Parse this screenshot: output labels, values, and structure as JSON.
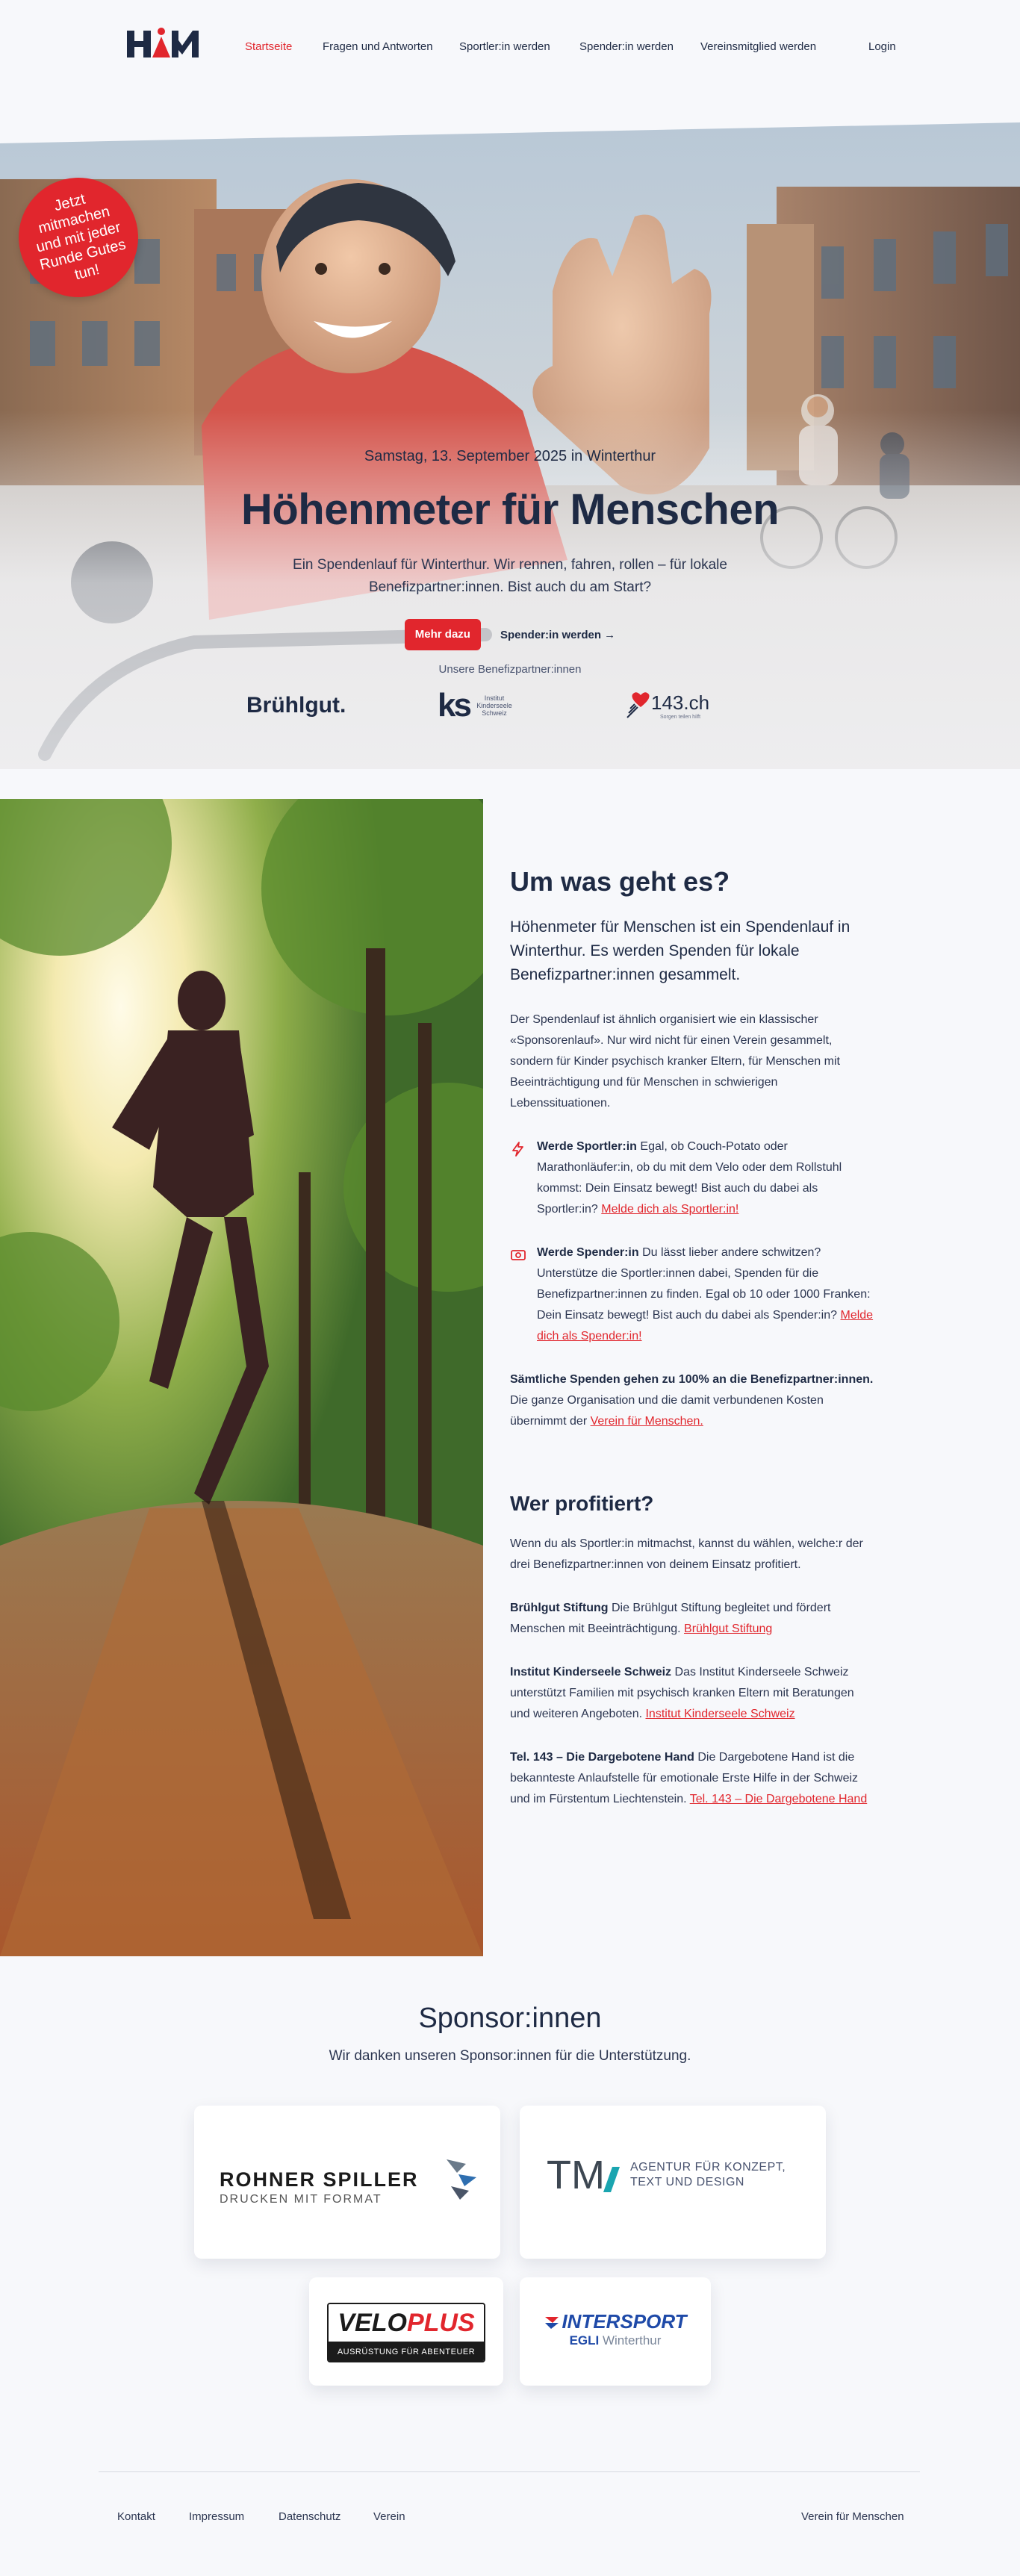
{
  "nav": {
    "items": [
      {
        "label": "Startseite",
        "active": true
      },
      {
        "label": "Fragen und Antworten",
        "active": false
      },
      {
        "label": "Sportler:in werden",
        "active": false
      },
      {
        "label": "Spender:in werden",
        "active": false
      },
      {
        "label": "Vereinsmitglied werden",
        "active": false
      }
    ],
    "login": "Login"
  },
  "hero": {
    "badge": "Jetzt mitmachen und mit jeder Runde Gutes tun!",
    "date": "Samstag, 13. September 2025 in Winterthur",
    "title": "Höhenmeter für Menschen",
    "lead": "Ein Spendenlauf für Winterthur. Wir rennen, fahren, rollen – für lokale Benefizpartner:innen. Bist auch du am Start?",
    "primary_button": "Mehr dazu",
    "secondary_button": "Spender:in werden →",
    "partners_label": "Unsere Benefizpartner:innen",
    "partners": {
      "bruehlgut": "Brühlgut.",
      "kinderseele_mark": "ks",
      "kinderseele_text": "Institut Kinderseele Schweiz",
      "tel143": "143.ch",
      "tel143_sub": "Sorgen teilen hilft"
    }
  },
  "about": {
    "title": "Um was geht es?",
    "lead": "Höhenmeter für Menschen ist ein Spendenlauf in Winterthur. Es werden Spenden für lokale Benefizpartner:innen gesammelt.",
    "body": "Der Spendenlauf ist ähnlich organisiert wie ein klassischer «Sponsorenlauf». Nur wird nicht für einen Verein gesammelt, sondern für Kinder psychisch kranker Eltern, für Menschen mit Beeinträchtigung und für Menschen in schwierigen Lebenssituationen.",
    "sportler": {
      "bold": "Werde Sportler:in",
      "text": " Egal, ob Couch-Potato oder Marathonläufer:in, ob du mit dem Velo oder dem Rollstuhl kommst: Dein Einsatz bewegt! Bist auch du dabei als Sportler:in? ",
      "link": "Melde dich als Sportler:in!"
    },
    "spender": {
      "bold": "Werde Spender:in",
      "text": " Du lässt lieber andere schwitzen? Unterstütze die Sportler:innen dabei, Spenden für die Benefizpartner:innen zu finden. Egal ob 10 oder 1000 Franken: Dein Einsatz bewegt! Bist auch du dabei als Spender:in? ",
      "link": "Melde dich als Spender:in!"
    },
    "spenden": {
      "bold": "Sämtliche Spenden gehen zu 100% an die Benefizpartner:innen.",
      "text": " Die ganze Organisation und die damit verbundenen Kosten übernimmt der ",
      "link": "Verein für Menschen."
    },
    "profit_title": "Wer profitiert?",
    "profit_intro": "Wenn du als Sportler:in mitmachst, kannst du wählen, welche:r der drei Benefizpartner:innen von deinem Einsatz profitiert.",
    "partners": [
      {
        "name": "Brühlgut Stiftung",
        "text": " Die Brühlgut Stiftung begleitet und fördert Menschen mit Beeinträchtigung. ",
        "link": "Brühlgut Stiftung"
      },
      {
        "name": "Institut Kinderseele Schweiz",
        "text": " Das Institut Kinderseele Schweiz unterstützt Familien mit psychisch kranken Eltern mit Beratungen und weiteren Angeboten. ",
        "link": "Institut Kinderseele Schweiz"
      },
      {
        "name": "Tel. 143 – Die Dargebotene Hand",
        "text": " Die Dargebotene Hand ist die bekannteste Anlaufstelle für emotionale Erste Hilfe in der Schweiz und im Fürstentum Liechtenstein. ",
        "link": "Tel. 143 – Die Dargebotene Hand"
      }
    ]
  },
  "sponsors": {
    "title": "Sponsor:innen",
    "subtitle": "Wir danken unseren Sponsor:innen für die Unterstützung.",
    "rohner": {
      "name": "ROHNER SPILLER",
      "tagline": "DRUCKEN MIT FORMAT"
    },
    "tm": {
      "mark": "TM",
      "line1": "AGENTUR FÜR KONZEPT,",
      "line2": "TEXT UND DESIGN"
    },
    "veloplus": {
      "velo": "VELO",
      "plus": "PLUS",
      "tagline": "AUSRÜSTUNG FÜR ABENTEUER"
    },
    "intersport": {
      "name": "INTERSPORT",
      "line2a": "EGLI",
      "line2b": " Winterthur"
    }
  },
  "footer": {
    "links": [
      "Kontakt",
      "Impressum",
      "Datenschutz",
      "Verein"
    ],
    "right": "Verein für Menschen"
  },
  "colors": {
    "accent": "#e1262d",
    "navy": "#1e2a44",
    "background": "#f7f8fb"
  }
}
